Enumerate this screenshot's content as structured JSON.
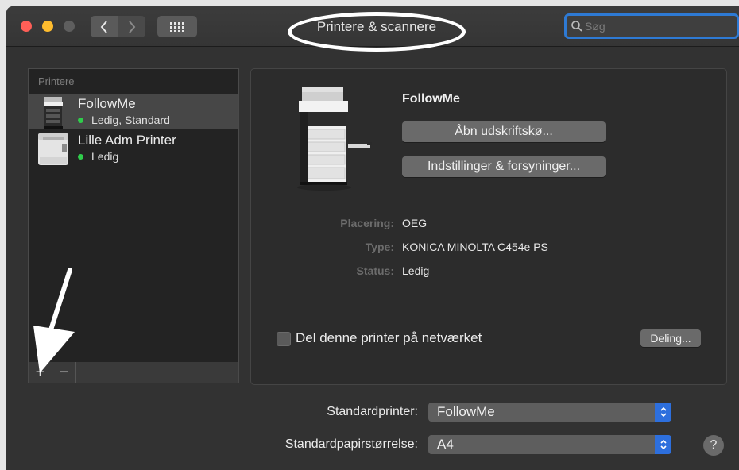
{
  "window": {
    "title": "Printere & scannere"
  },
  "search": {
    "placeholder": "Søg"
  },
  "sidebar": {
    "header": "Printere",
    "printers": [
      {
        "name": "FollowMe",
        "status": "Ledig, Standard"
      },
      {
        "name": "Lille Adm Printer",
        "status": "Ledig"
      }
    ],
    "add_symbol": "+",
    "remove_symbol": "−"
  },
  "detail": {
    "name": "FollowMe",
    "open_queue_label": "Åbn udskriftskø...",
    "options_label": "Indstillinger & forsyninger...",
    "location_label": "Placering:",
    "location_value": "OEG",
    "type_label": "Type:",
    "type_value": "KONICA MINOLTA C454e PS",
    "status_label": "Status:",
    "status_value": "Ledig",
    "share_label": "Del denne printer på netværket",
    "sharing_button": "Deling..."
  },
  "defaults": {
    "printer_label": "Standardprinter:",
    "printer_value": "FollowMe",
    "paper_label": "Standardpapirstørrelse:",
    "paper_value": "A4"
  },
  "help_symbol": "?",
  "colors": {
    "accent": "#2d6fdd",
    "status_dot": "#2fcc4b",
    "annotation": "#ffffff"
  }
}
